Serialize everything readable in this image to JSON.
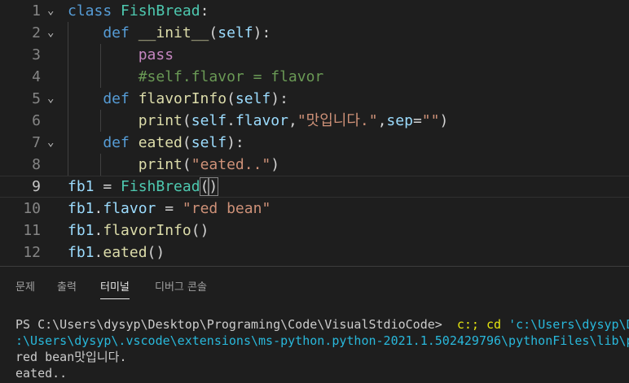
{
  "editor": {
    "lines": [
      {
        "num": "1",
        "fold": true,
        "tokens": [
          {
            "t": "class ",
            "c": "kw"
          },
          {
            "t": "FishBread",
            "c": "cls"
          },
          {
            "t": ":",
            "c": "plain"
          }
        ]
      },
      {
        "num": "2",
        "fold": true,
        "tokens": [
          {
            "t": "    def ",
            "c": "kw"
          },
          {
            "t": "__init__",
            "c": "fn"
          },
          {
            "t": "(",
            "c": "plain"
          },
          {
            "t": "self",
            "c": "param"
          },
          {
            "t": "):",
            "c": "plain"
          }
        ]
      },
      {
        "num": "3",
        "fold": false,
        "tokens": [
          {
            "t": "        pass",
            "c": "ctrl"
          }
        ]
      },
      {
        "num": "4",
        "fold": false,
        "tokens": [
          {
            "t": "        #self.flavor = flavor",
            "c": "cmt"
          }
        ]
      },
      {
        "num": "5",
        "fold": true,
        "tokens": [
          {
            "t": "    def ",
            "c": "kw"
          },
          {
            "t": "flavorInfo",
            "c": "fn"
          },
          {
            "t": "(",
            "c": "plain"
          },
          {
            "t": "self",
            "c": "param"
          },
          {
            "t": "):",
            "c": "plain"
          }
        ]
      },
      {
        "num": "6",
        "fold": false,
        "tokens": [
          {
            "t": "        ",
            "c": "plain"
          },
          {
            "t": "print",
            "c": "fn"
          },
          {
            "t": "(",
            "c": "plain"
          },
          {
            "t": "self",
            "c": "param"
          },
          {
            "t": ".",
            "c": "plain"
          },
          {
            "t": "flavor",
            "c": "param"
          },
          {
            "t": ",",
            "c": "plain"
          },
          {
            "t": "\"맛입니다.\"",
            "c": "str"
          },
          {
            "t": ",",
            "c": "plain"
          },
          {
            "t": "sep",
            "c": "param"
          },
          {
            "t": "=",
            "c": "plain"
          },
          {
            "t": "\"\"",
            "c": "str"
          },
          {
            "t": ")",
            "c": "plain"
          }
        ]
      },
      {
        "num": "7",
        "fold": true,
        "tokens": [
          {
            "t": "    def ",
            "c": "kw"
          },
          {
            "t": "eated",
            "c": "fn"
          },
          {
            "t": "(",
            "c": "plain"
          },
          {
            "t": "self",
            "c": "param"
          },
          {
            "t": "):",
            "c": "plain"
          }
        ]
      },
      {
        "num": "8",
        "fold": false,
        "tokens": [
          {
            "t": "        ",
            "c": "plain"
          },
          {
            "t": "print",
            "c": "fn"
          },
          {
            "t": "(",
            "c": "plain"
          },
          {
            "t": "\"eated..\"",
            "c": "str"
          },
          {
            "t": ")",
            "c": "plain"
          }
        ]
      },
      {
        "num": "9",
        "fold": false,
        "current": true,
        "tokens": [
          {
            "t": "fb1",
            "c": "param"
          },
          {
            "t": " = ",
            "c": "plain"
          },
          {
            "t": "FishBread",
            "c": "cls"
          },
          {
            "t": "(",
            "c": "brk"
          },
          {
            "t": ")",
            "c": "brk"
          }
        ]
      },
      {
        "num": "10",
        "fold": false,
        "tokens": [
          {
            "t": "fb1",
            "c": "param"
          },
          {
            "t": ".",
            "c": "plain"
          },
          {
            "t": "flavor",
            "c": "param"
          },
          {
            "t": " = ",
            "c": "plain"
          },
          {
            "t": "\"red bean\"",
            "c": "str"
          }
        ]
      },
      {
        "num": "11",
        "fold": false,
        "tokens": [
          {
            "t": "fb1",
            "c": "param"
          },
          {
            "t": ".",
            "c": "plain"
          },
          {
            "t": "flavorInfo",
            "c": "fn"
          },
          {
            "t": "()",
            "c": "plain"
          }
        ]
      },
      {
        "num": "12",
        "fold": false,
        "tokens": [
          {
            "t": "fb1",
            "c": "param"
          },
          {
            "t": ".",
            "c": "plain"
          },
          {
            "t": "eated",
            "c": "fn"
          },
          {
            "t": "()",
            "c": "plain"
          }
        ]
      }
    ]
  },
  "panel": {
    "tabs": [
      {
        "label": "문제",
        "active": false
      },
      {
        "label": "출력",
        "active": false
      },
      {
        "label": "터미널",
        "active": true
      },
      {
        "label": "디버그 콘솔",
        "active": false
      }
    ],
    "terminal": {
      "lines": [
        [
          {
            "t": "PS C:\\Users\\dysyp\\Desktop\\Programing\\Code\\VisualStdioCode>  ",
            "c": "t-plain"
          },
          {
            "t": "c:; cd ",
            "c": "t-yellow"
          },
          {
            "t": "'c:\\Users\\dysyp\\Desktop\\Programing\\Code\\VisualStdioCode'",
            "c": "t-cyan"
          }
        ],
        [
          {
            "t": ":\\Users\\dysyp\\.vscode\\extensions\\ms-python.python-2021.1.502429796\\pythonFiles\\lib\\python\\debugpy\\launcher",
            "c": "t-cyan"
          }
        ],
        [
          {
            "t": "red bean맛입니다.",
            "c": "t-plain"
          }
        ],
        [
          {
            "t": "eated..",
            "c": "t-plain"
          }
        ]
      ]
    }
  },
  "colors": {
    "background": "#1e1e1e",
    "keyword": "#569cd6",
    "class": "#4ec9b0",
    "function": "#dcdcaa",
    "variable": "#9cdcfe",
    "control": "#c586c0",
    "comment": "#6a9955",
    "string": "#ce9178"
  }
}
